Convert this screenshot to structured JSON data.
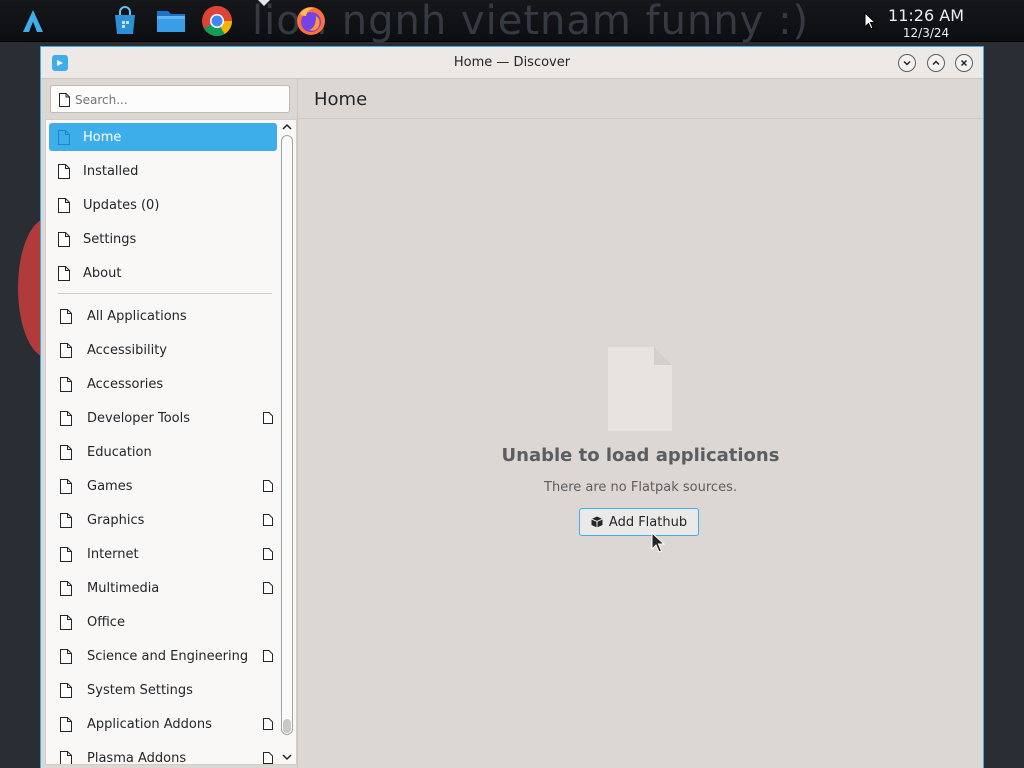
{
  "taskbar": {
    "wallpaper_text": "lion ngnh vietnam funny :)",
    "time": "11:26 AM",
    "date": "12/3/24",
    "icons": [
      "launcher-icon",
      "discover-store-icon",
      "file-manager-icon",
      "chrome-icon",
      "firefox-icon"
    ]
  },
  "window": {
    "title": "Home — Discover",
    "buttons": [
      "minimize",
      "maximize",
      "close"
    ]
  },
  "search": {
    "placeholder": "Search..."
  },
  "sidebar": {
    "items": [
      {
        "label": "Home",
        "active": true
      },
      {
        "label": "Installed"
      },
      {
        "label": "Updates (0)"
      },
      {
        "label": "Settings"
      },
      {
        "label": "About"
      }
    ],
    "categories": [
      {
        "label": "All Applications",
        "has_sub": false
      },
      {
        "label": "Accessibility",
        "has_sub": false
      },
      {
        "label": "Accessories",
        "has_sub": false
      },
      {
        "label": "Developer Tools",
        "has_sub": true
      },
      {
        "label": "Education",
        "has_sub": false
      },
      {
        "label": "Games",
        "has_sub": true
      },
      {
        "label": "Graphics",
        "has_sub": true
      },
      {
        "label": "Internet",
        "has_sub": true
      },
      {
        "label": "Multimedia",
        "has_sub": true
      },
      {
        "label": "Office",
        "has_sub": false
      },
      {
        "label": "Science and Engineering",
        "has_sub": true
      },
      {
        "label": "System Settings",
        "has_sub": false
      },
      {
        "label": "Application Addons",
        "has_sub": true
      },
      {
        "label": "Plasma Addons",
        "has_sub": true
      }
    ]
  },
  "main": {
    "page_title": "Home",
    "empty_title": "Unable to load applications",
    "empty_subtitle": "There are no Flatpak sources.",
    "add_button_label": "Add Flathub"
  },
  "colors": {
    "accent": "#3daee9",
    "window_bg": "#dcd7d2",
    "text": "#232629",
    "muted_text": "#5a5d61"
  }
}
